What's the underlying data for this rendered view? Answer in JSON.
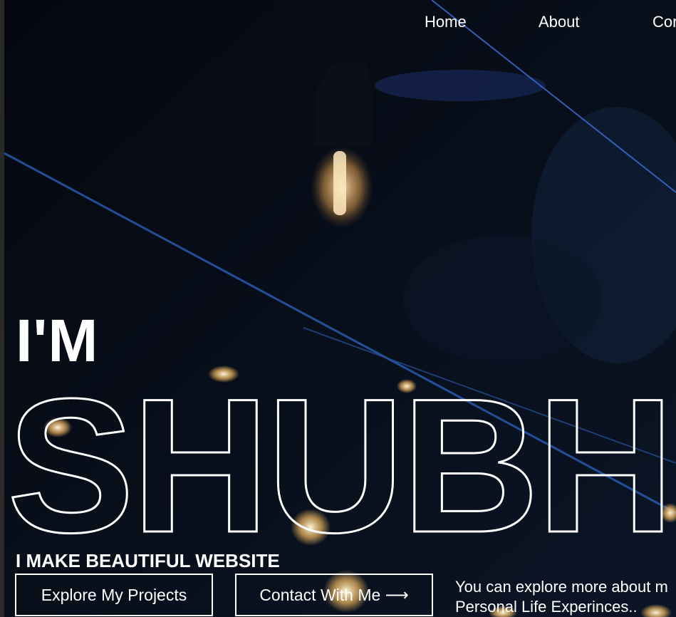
{
  "nav": {
    "home": "Home",
    "about": "About",
    "contact_partial": "Cor"
  },
  "hero": {
    "intro": "I'M",
    "name": "SHUBH",
    "tagline": "I MAKE BEAUTIFUL WEBSITE",
    "projects_button": "Explore My Projects",
    "contact_button": "Contact With Me ⟶",
    "about_line1": "You can explore more about m",
    "about_line2": "Personal Life Experinces.."
  },
  "colors": {
    "background": "#070b14",
    "text": "#ffffff",
    "bulb_glow": "#f3c27a",
    "accent_line": "#2a5fb8"
  }
}
